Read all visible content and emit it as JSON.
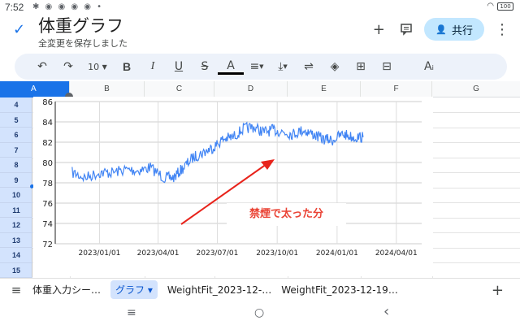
{
  "status_bar": {
    "time": "7:52",
    "icons": "✱ ◉ ◉ ◉ ◉ •",
    "battery": "100"
  },
  "header": {
    "title": "体重グラフ",
    "save_status": "全変更を保存しました",
    "share_label": "共行"
  },
  "toolbar": {
    "undo_icon": "↶",
    "redo_icon": "↷",
    "font_size": "10",
    "bold": "B",
    "italic": "I",
    "underline": "U",
    "strike": "S",
    "text_color": "A",
    "align": "≡",
    "valign": "⤓",
    "wrap": "⇌",
    "fill": "◈",
    "insert_col": "⊞",
    "insert_row": "⊟",
    "text_format": "Aᵢ"
  },
  "grid": {
    "columns": [
      "A",
      "B",
      "C",
      "D",
      "E",
      "F",
      "G"
    ],
    "rows": [
      "4",
      "5",
      "6",
      "7",
      "8",
      "9",
      "10",
      "11",
      "12",
      "13",
      "14",
      "15"
    ]
  },
  "chart_data": {
    "type": "line",
    "title": "",
    "xlabel": "",
    "ylabel": "",
    "ylim": [
      72,
      86
    ],
    "yticks": [
      "72",
      "74",
      "76",
      "78",
      "80",
      "82",
      "84",
      "86"
    ],
    "xticks": [
      "2023/01/01",
      "2023/04/01",
      "2023/07/01",
      "2023/10/01",
      "2024/01/01",
      "2024/04/01"
    ],
    "series": [
      {
        "color": "#4285f4",
        "x": [
          "2022/11/20",
          "2022/12/10",
          "2023/01/01",
          "2023/01/20",
          "2023/02/10",
          "2023/03/01",
          "2023/03/20",
          "2023/04/10",
          "2023/04/25",
          "2023/05/10",
          "2023/05/25",
          "2023/06/10",
          "2023/06/25",
          "2023/07/10",
          "2023/07/25",
          "2023/08/10",
          "2023/08/25",
          "2023/09/10",
          "2023/09/25",
          "2023/10/10",
          "2023/10/25",
          "2023/11/10",
          "2023/11/25",
          "2023/12/10",
          "2023/12/25",
          "2024/01/10",
          "2024/01/25",
          "2024/02/10"
        ],
        "values": [
          79,
          78.5,
          79,
          79,
          79.3,
          79.2,
          79.5,
          78.5,
          78.5,
          79.5,
          80.5,
          81,
          81.5,
          82.3,
          82.5,
          83.3,
          83.5,
          83,
          83.2,
          83,
          82.8,
          83.2,
          82.8,
          82.3,
          82.2,
          82.8,
          82.5,
          82.5
        ]
      }
    ],
    "annotation": "禁煙で太った分",
    "arrow_color": "#e8231b",
    "grid": true
  },
  "tabs": {
    "items": [
      "体重入力シー…",
      "グラフ ▾",
      "WeightFit_2023-12-…",
      "WeightFit_2023-12-19…"
    ],
    "add": "+"
  },
  "nav": {
    "recents": "≡",
    "home": "○",
    "back": "‹"
  }
}
